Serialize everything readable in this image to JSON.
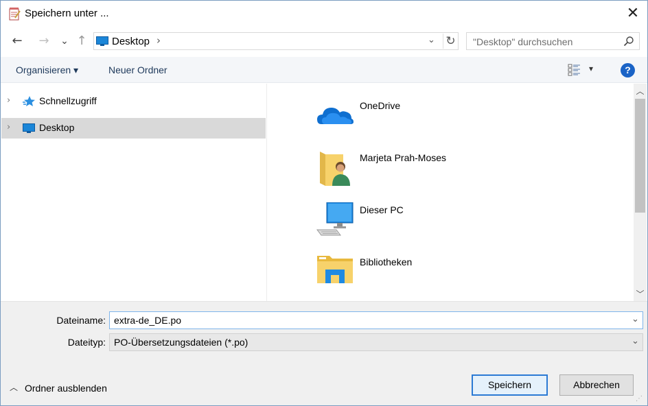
{
  "window": {
    "title": "Speichern unter ...",
    "close_glyph": "✕"
  },
  "nav": {
    "back_glyph": "←",
    "forward_glyph": "→",
    "recent_glyph": "⌄",
    "up_glyph": "↑"
  },
  "address": {
    "location": "Desktop",
    "chevron": "›",
    "dropdown_glyph": "⌄",
    "refresh_glyph": "↻"
  },
  "search": {
    "placeholder": "\"Desktop\" durchsuchen"
  },
  "toolbar": {
    "organize_label": "Organisieren ▾",
    "new_folder_label": "Neuer Ordner",
    "view_drop_glyph": "▾",
    "help_label": "?"
  },
  "tree": {
    "items": [
      {
        "label": "Schnellzugriff",
        "icon": "quick-access-star-icon",
        "selected": false
      },
      {
        "label": "Desktop",
        "icon": "desktop-icon",
        "selected": true
      }
    ],
    "chevron": "›"
  },
  "files": [
    {
      "label": "OneDrive",
      "icon": "onedrive-cloud-icon"
    },
    {
      "label": "Marjeta Prah-Moses",
      "icon": "user-folder-icon"
    },
    {
      "label": "Dieser PC",
      "icon": "computer-icon"
    },
    {
      "label": "Bibliotheken",
      "icon": "libraries-folder-icon"
    }
  ],
  "scrollbar": {
    "up_glyph": "︿",
    "down_glyph": "﹀"
  },
  "form": {
    "filename_label": "Dateiname:",
    "filename_value": "extra-de_DE.po",
    "filetype_label": "Dateityp:",
    "filetype_value": "PO-Übersetzungsdateien (*.po)",
    "dropdown_glyph": "⌄"
  },
  "footer": {
    "hide_folders_label": "Ordner ausblenden",
    "hide_chevron": "︿",
    "save_label": "Speichern",
    "cancel_label": "Abbrechen"
  },
  "colors": {
    "accent": "#2a79d4",
    "selection": "#d9d9d9",
    "toolbar_text": "#1e395b",
    "help_blue": "#1a63c6"
  }
}
